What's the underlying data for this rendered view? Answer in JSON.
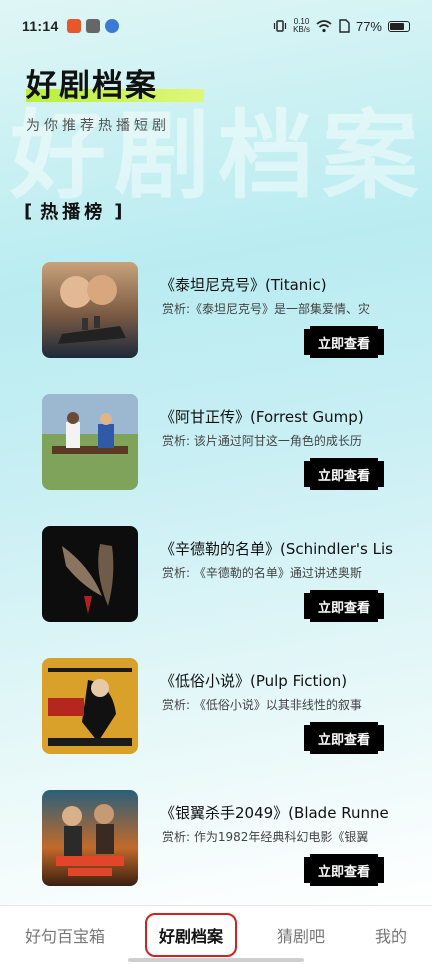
{
  "status_bar": {
    "time": "11:14",
    "net_speed": "0.10",
    "net_unit": "KB/s",
    "battery": "77%"
  },
  "header": {
    "watermark": "好剧档案",
    "title": "好剧档案",
    "subtitle": "为你推荐热播短剧"
  },
  "section": {
    "bracket_left": "[",
    "title": "热播榜",
    "bracket_right": "]"
  },
  "items": [
    {
      "title": "《泰坦尼克号》(Titanic)",
      "desc": "赏析:《泰坦尼克号》是一部集爱情、灾",
      "button": "立即查看"
    },
    {
      "title": "《阿甘正传》(Forrest Gump)",
      "desc": "赏析:  该片通过阿甘这一角色的成长历",
      "button": "立即查看"
    },
    {
      "title": "《辛德勒的名单》(Schindler's Lis",
      "desc": "赏析:  《辛德勒的名单》通过讲述奥斯",
      "button": "立即查看"
    },
    {
      "title": "《低俗小说》(Pulp Fiction)",
      "desc": "赏析:  《低俗小说》以其非线性的叙事",
      "button": "立即查看"
    },
    {
      "title": "《银翼杀手2049》(Blade Runne",
      "desc": "赏析:  作为1982年经典科幻电影《银翼",
      "button": "立即查看"
    }
  ],
  "tabs": [
    {
      "label": "好句百宝箱"
    },
    {
      "label": "好剧档案"
    },
    {
      "label": "猜剧吧"
    },
    {
      "label": "我的"
    }
  ]
}
